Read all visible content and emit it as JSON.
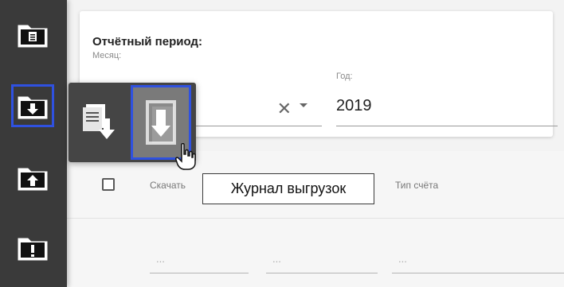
{
  "sidebar": {
    "items": [
      {
        "name": "documents-folder-icon"
      },
      {
        "name": "download-folder-icon",
        "active": true
      },
      {
        "name": "upload-folder-icon"
      },
      {
        "name": "warning-folder-icon"
      }
    ]
  },
  "period": {
    "title": "Отчётный период:",
    "month_label": "Месяц:",
    "month_value": "",
    "year_label": "Год:",
    "year_value": "2019"
  },
  "table": {
    "columns": {
      "download": "Скачать",
      "account_type": "Тип счёта"
    },
    "filters": {
      "one": "...",
      "two": "...",
      "three": "..."
    }
  },
  "popup": {
    "tooltip": "Журнал выгрузок"
  },
  "colors": {
    "sidebar_bg": "#3a3a3a",
    "active_border": "#2f51e0"
  }
}
